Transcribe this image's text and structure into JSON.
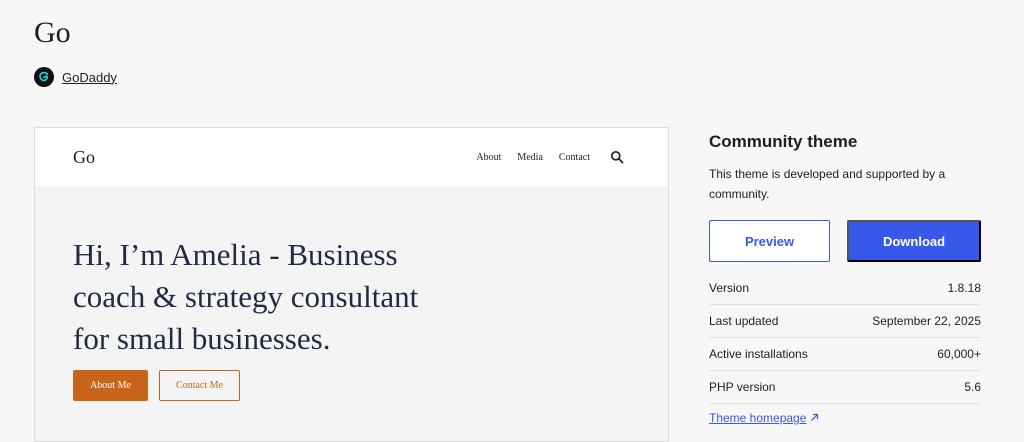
{
  "page": {
    "title": "Go"
  },
  "author": {
    "name": "GoDaddy",
    "logo": "godaddy-logo-icon"
  },
  "preview": {
    "logo": "Go",
    "nav": [
      "About",
      "Media",
      "Contact"
    ],
    "search_icon": "search-icon",
    "headline": "Hi, I’m Amelia - Business coach & strategy consultant for small businesses.",
    "primary_button": "About Me",
    "secondary_button": "Contact Me",
    "accent_color": "#c7641a",
    "headline_color": "#1f2a44"
  },
  "sidebar": {
    "heading": "Community theme",
    "description": "This theme is developed and supported by a community.",
    "preview_button": "Preview",
    "download_button": "Download",
    "accent_color": "#3858e9",
    "meta": [
      {
        "label": "Version",
        "value": "1.8.18"
      },
      {
        "label": "Last updated",
        "value": "September 22, 2025"
      },
      {
        "label": "Active installations",
        "value": "60,000+"
      },
      {
        "label": "PHP version",
        "value": "5.6"
      }
    ],
    "homepage_link": "Theme homepage",
    "homepage_icon": "external-link-icon"
  }
}
